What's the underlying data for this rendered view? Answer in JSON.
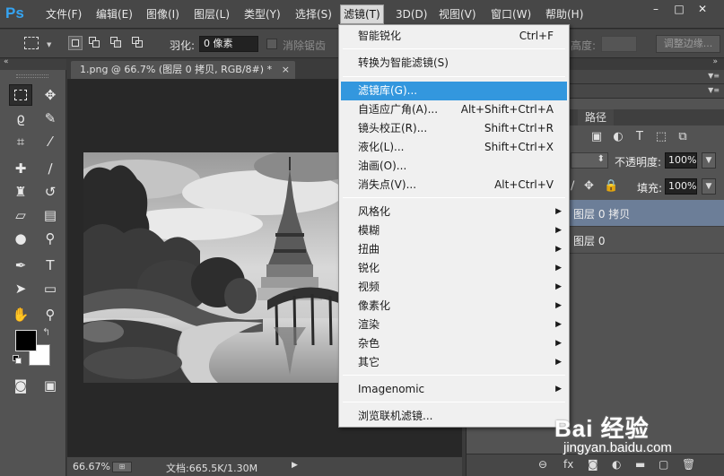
{
  "app": {
    "logo": "Ps"
  },
  "menubar": {
    "items": [
      {
        "label": "文件(F)"
      },
      {
        "label": "编辑(E)"
      },
      {
        "label": "图像(I)"
      },
      {
        "label": "图层(L)"
      },
      {
        "label": "类型(Y)"
      },
      {
        "label": "选择(S)"
      },
      {
        "label": "滤镜(T)"
      },
      {
        "label": "3D(D)"
      },
      {
        "label": "视图(V)"
      },
      {
        "label": "窗口(W)"
      },
      {
        "label": "帮助(H)"
      }
    ],
    "window_buttons": {
      "minimize": "–",
      "maximize": "□",
      "close": "✕"
    }
  },
  "options": {
    "feather_label": "羽化:",
    "feather_value": "0 像素",
    "antialias_label": "消除锯齿",
    "height_label": "高度:",
    "refine_edge_label": "调整边缘..."
  },
  "document": {
    "tab_title": "1.png @ 66.7% (图层 0 拷贝, RGB/8#) *",
    "tab_close": "×"
  },
  "status": {
    "zoom": "66.67%",
    "doc_info": "文档:665.5K/1.30M"
  },
  "panels": {
    "paths_tab": "路径",
    "opacity_label": "不透明度:",
    "opacity_value": "100%",
    "fill_label": "填充:",
    "fill_value": "100%",
    "layers": [
      {
        "name": "图层 0 拷贝",
        "selected": true
      },
      {
        "name": "图层 0",
        "selected": false
      }
    ]
  },
  "filter_menu": {
    "items": [
      {
        "label": "智能锐化",
        "shortcut": "Ctrl+F"
      },
      {
        "label": "转换为智能滤镜(S)",
        "shortcut": ""
      },
      {
        "label": "滤镜库(G)...",
        "shortcut": "",
        "highlighted": true
      },
      {
        "label": "自适应广角(A)...",
        "shortcut": "Alt+Shift+Ctrl+A"
      },
      {
        "label": "镜头校正(R)...",
        "shortcut": "Shift+Ctrl+R"
      },
      {
        "label": "液化(L)...",
        "shortcut": "Shift+Ctrl+X"
      },
      {
        "label": "油画(O)...",
        "shortcut": ""
      },
      {
        "label": "消失点(V)...",
        "shortcut": "Alt+Ctrl+V"
      },
      {
        "label": "风格化",
        "submenu": true
      },
      {
        "label": "模糊",
        "submenu": true
      },
      {
        "label": "扭曲",
        "submenu": true
      },
      {
        "label": "锐化",
        "submenu": true
      },
      {
        "label": "视频",
        "submenu": true
      },
      {
        "label": "像素化",
        "submenu": true
      },
      {
        "label": "渲染",
        "submenu": true
      },
      {
        "label": "杂色",
        "submenu": true
      },
      {
        "label": "其它",
        "submenu": true
      },
      {
        "label": "Imagenomic",
        "submenu": true
      },
      {
        "label": "浏览联机滤镜...",
        "shortcut": ""
      }
    ]
  },
  "watermark": {
    "logo": "Bai 经验",
    "url": "jingyan.baidu.com"
  },
  "colors": {
    "menu_highlight": "#3397de",
    "layer_selected": "#6c7e98",
    "ps_blue": "#35a4f2"
  }
}
